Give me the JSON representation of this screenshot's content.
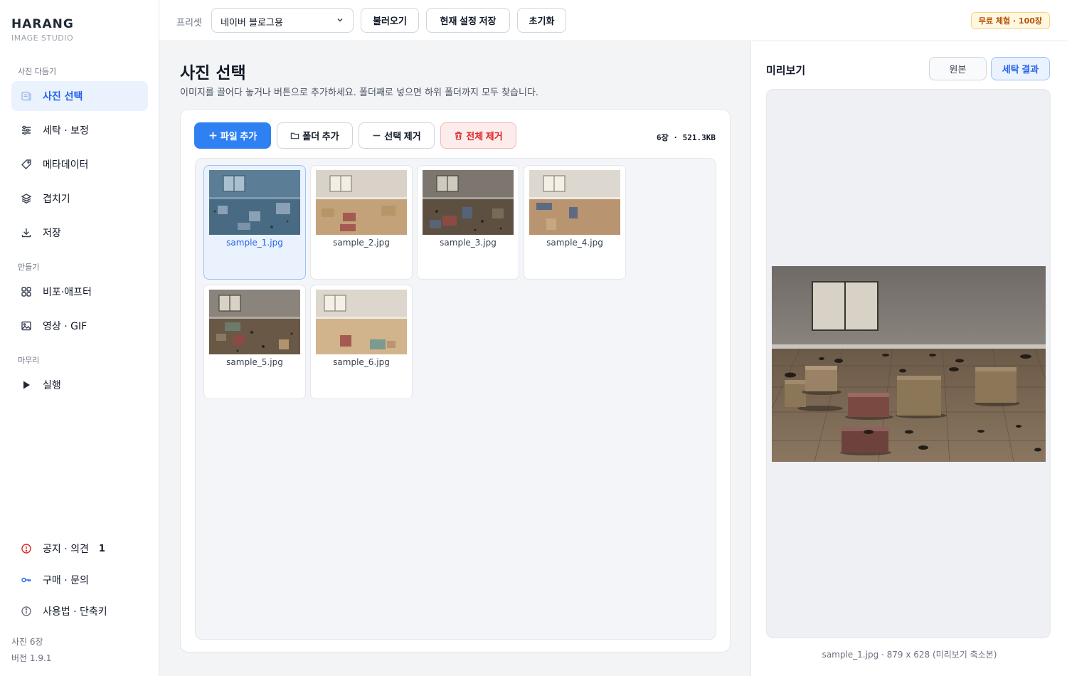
{
  "brand": {
    "title": "HARANG",
    "subtitle": "IMAGE STUDIO"
  },
  "sidebar": {
    "sections": [
      {
        "label": "사진 다듬기"
      },
      {
        "label": "만들기"
      },
      {
        "label": "마무리"
      }
    ],
    "items": [
      {
        "label": "사진 선택",
        "icon": "photo-select-icon",
        "active": true
      },
      {
        "label": "세탁 · 보정",
        "icon": "sliders-icon"
      },
      {
        "label": "메타데이터",
        "icon": "tag-icon"
      },
      {
        "label": "겹치기",
        "icon": "layers-icon"
      },
      {
        "label": "저장",
        "icon": "download-icon"
      },
      {
        "label": "비포·애프터",
        "icon": "grid-icon"
      },
      {
        "label": "영상 · GIF",
        "icon": "image-icon"
      },
      {
        "label": "실행",
        "icon": "play-icon"
      }
    ],
    "bottom_items": [
      {
        "label": "공지 · 의견",
        "badge": "1",
        "icon": "alert-icon",
        "color": "#dc2626"
      },
      {
        "label": "구매 · 문의",
        "icon": "key-icon",
        "color": "#2563eb"
      },
      {
        "label": "사용법 · 단축키",
        "icon": "info-icon",
        "color": "#6b7280"
      }
    ],
    "footer": {
      "photo_count": "사진 6장",
      "version": "버전 1.9.1"
    }
  },
  "topbar": {
    "preset_label": "프리셋",
    "preset_value": "네이버 블로그용",
    "load_label": "불러오기",
    "save_label": "현재 설정 저장",
    "reset_label": "초기화",
    "trial_badge": "무료 체험 · 100장"
  },
  "main": {
    "title": "사진 선택",
    "description": "이미지를 끌어다 놓거나 버튼으로 추가하세요. 폴더째로 넣으면 하위 폴더까지 모두 찾습니다.",
    "toolbar": {
      "add_file": "파일 추가",
      "add_folder": "폴더 추가",
      "remove_selected": "선택 제거",
      "remove_all": "전체 제거",
      "count_info": "6장 · 521.3KB"
    },
    "files": [
      {
        "name": "sample_1.jpg",
        "selected": true
      },
      {
        "name": "sample_2.jpg"
      },
      {
        "name": "sample_3.jpg"
      },
      {
        "name": "sample_4.jpg"
      },
      {
        "name": "sample_5.jpg"
      },
      {
        "name": "sample_6.jpg"
      }
    ]
  },
  "preview": {
    "title": "미리보기",
    "tab_original": "원본",
    "tab_result": "세탁 결과",
    "caption": "sample_1.jpg  ·  879 x 628 (미리보기 축소본)"
  },
  "colors": {
    "accent": "#2f80f3",
    "danger": "#dc2626",
    "trial": "#b45309"
  }
}
